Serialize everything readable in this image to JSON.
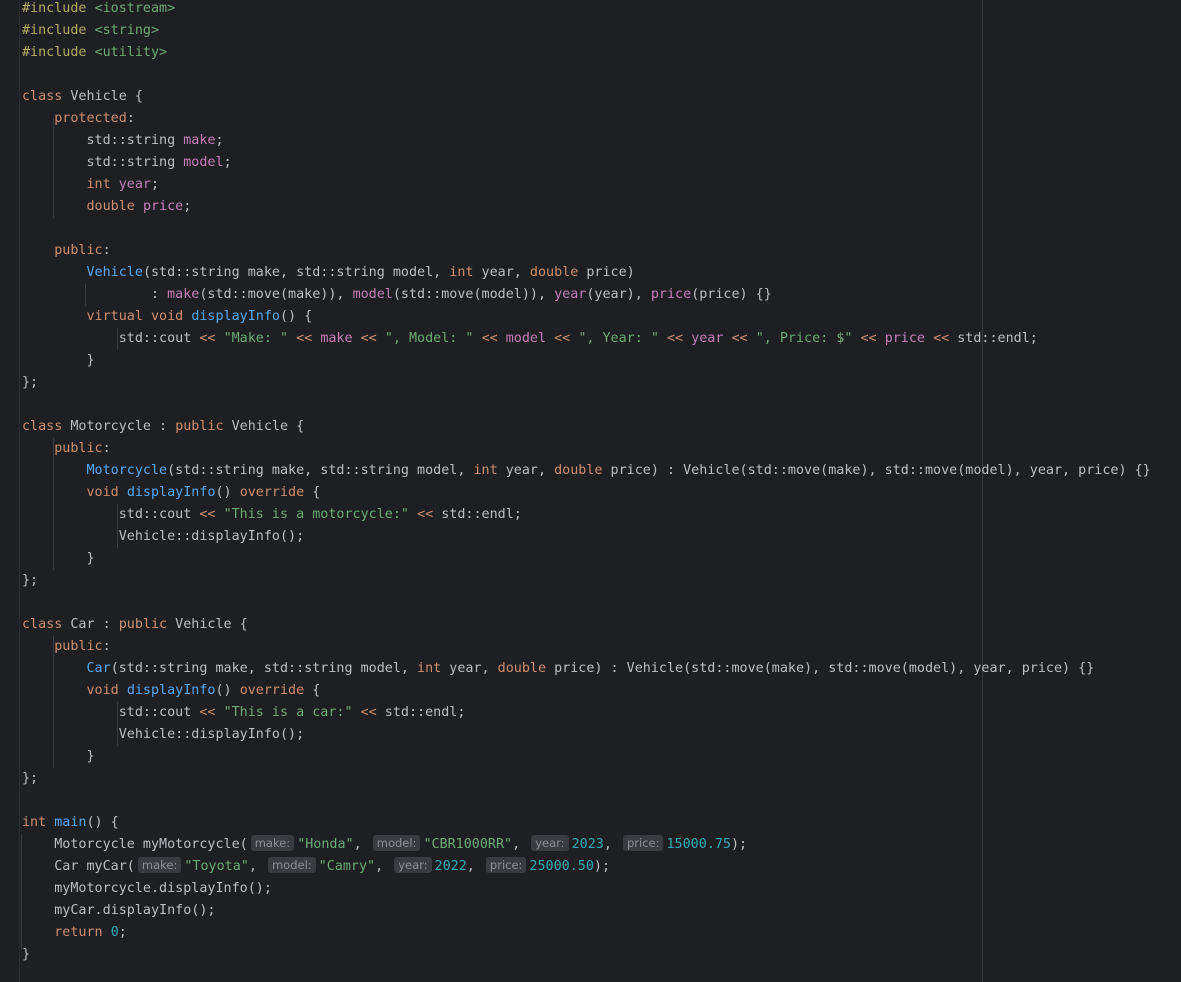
{
  "editor": {
    "language": "C++",
    "colors": {
      "background": "#1e1f22",
      "text": "#bcbec4",
      "keyword": "#cf8e6d",
      "string": "#6aab73",
      "number": "#2aacb8",
      "function": "#56a8f5",
      "field": "#c77dbb",
      "preprocessor": "#b3ae60",
      "inlay_hint": "#393b40"
    },
    "lines": [
      [
        [
          "pp",
          "#include"
        ],
        [
          "t",
          " "
        ],
        [
          "inc",
          "<iostream>"
        ]
      ],
      [
        [
          "pp",
          "#include"
        ],
        [
          "t",
          " "
        ],
        [
          "inc",
          "<string>"
        ]
      ],
      [
        [
          "pp",
          "#include"
        ],
        [
          "t",
          " "
        ],
        [
          "inc",
          "<utility>"
        ]
      ],
      [],
      [
        [
          "kw",
          "class"
        ],
        [
          "t",
          " Vehicle {"
        ]
      ],
      [
        [
          "t",
          "    "
        ],
        [
          "kw",
          "protected"
        ],
        [
          "t",
          ":"
        ]
      ],
      [
        [
          "t",
          "        std::string "
        ],
        [
          "fld",
          "make"
        ],
        [
          "t",
          ";"
        ]
      ],
      [
        [
          "t",
          "        std::string "
        ],
        [
          "fld",
          "model"
        ],
        [
          "t",
          ";"
        ]
      ],
      [
        [
          "t",
          "        "
        ],
        [
          "kw",
          "int"
        ],
        [
          "t",
          " "
        ],
        [
          "fld",
          "year"
        ],
        [
          "t",
          ";"
        ]
      ],
      [
        [
          "t",
          "        "
        ],
        [
          "kw",
          "double"
        ],
        [
          "t",
          " "
        ],
        [
          "fld",
          "price"
        ],
        [
          "t",
          ";"
        ]
      ],
      [],
      [
        [
          "t",
          "    "
        ],
        [
          "kw",
          "public"
        ],
        [
          "t",
          ":"
        ]
      ],
      [
        [
          "t",
          "        "
        ],
        [
          "fn",
          "Vehicle"
        ],
        [
          "t",
          "(std::string make, std::string model, "
        ],
        [
          "kw",
          "int"
        ],
        [
          "t",
          " year, "
        ],
        [
          "kw",
          "double"
        ],
        [
          "t",
          " price)"
        ]
      ],
      [
        [
          "t",
          "                : "
        ],
        [
          "fld",
          "make"
        ],
        [
          "t",
          "(std::move(make)), "
        ],
        [
          "fld",
          "model"
        ],
        [
          "t",
          "(std::move(model)), "
        ],
        [
          "fld",
          "year"
        ],
        [
          "t",
          "(year), "
        ],
        [
          "fld",
          "price"
        ],
        [
          "t",
          "(price) {}"
        ]
      ],
      [
        [
          "t",
          "        "
        ],
        [
          "kw",
          "virtual"
        ],
        [
          "t",
          " "
        ],
        [
          "kw",
          "void"
        ],
        [
          "t",
          " "
        ],
        [
          "fn",
          "displayInfo"
        ],
        [
          "t",
          "() {"
        ]
      ],
      [
        [
          "t",
          "            std::cout "
        ],
        [
          "kw",
          "<<"
        ],
        [
          "t",
          " "
        ],
        [
          "str",
          "\"Make: \""
        ],
        [
          "t",
          " "
        ],
        [
          "kw",
          "<<"
        ],
        [
          "t",
          " "
        ],
        [
          "fld",
          "make"
        ],
        [
          "t",
          " "
        ],
        [
          "kw",
          "<<"
        ],
        [
          "t",
          " "
        ],
        [
          "str",
          "\", Model: \""
        ],
        [
          "t",
          " "
        ],
        [
          "kw",
          "<<"
        ],
        [
          "t",
          " "
        ],
        [
          "fld",
          "model"
        ],
        [
          "t",
          " "
        ],
        [
          "kw",
          "<<"
        ],
        [
          "t",
          " "
        ],
        [
          "str",
          "\", Year: \""
        ],
        [
          "t",
          " "
        ],
        [
          "kw",
          "<<"
        ],
        [
          "t",
          " "
        ],
        [
          "fld",
          "year"
        ],
        [
          "t",
          " "
        ],
        [
          "kw",
          "<<"
        ],
        [
          "t",
          " "
        ],
        [
          "str",
          "\", Price: $\""
        ],
        [
          "t",
          " "
        ],
        [
          "kw",
          "<<"
        ],
        [
          "t",
          " "
        ],
        [
          "fld",
          "price"
        ],
        [
          "t",
          " "
        ],
        [
          "kw",
          "<<"
        ],
        [
          "t",
          " std::endl;"
        ]
      ],
      [
        [
          "t",
          "        }"
        ]
      ],
      [
        [
          "t",
          "};"
        ]
      ],
      [],
      [
        [
          "kw",
          "class"
        ],
        [
          "t",
          " Motorcycle : "
        ],
        [
          "kw",
          "public"
        ],
        [
          "t",
          " Vehicle {"
        ]
      ],
      [
        [
          "t",
          "    "
        ],
        [
          "kw",
          "public"
        ],
        [
          "t",
          ":"
        ]
      ],
      [
        [
          "t",
          "        "
        ],
        [
          "fn",
          "Motorcycle"
        ],
        [
          "t",
          "(std::string make, std::string model, "
        ],
        [
          "kw",
          "int"
        ],
        [
          "t",
          " year, "
        ],
        [
          "kw",
          "double"
        ],
        [
          "t",
          " price) : Vehicle(std::move(make), std::move(model), year, price) {}"
        ]
      ],
      [
        [
          "t",
          "        "
        ],
        [
          "kw",
          "void"
        ],
        [
          "t",
          " "
        ],
        [
          "fn",
          "displayInfo"
        ],
        [
          "t",
          "() "
        ],
        [
          "kw",
          "override"
        ],
        [
          "t",
          " {"
        ]
      ],
      [
        [
          "t",
          "            std::cout "
        ],
        [
          "kw",
          "<<"
        ],
        [
          "t",
          " "
        ],
        [
          "str",
          "\"This is a motorcycle:\""
        ],
        [
          "t",
          " "
        ],
        [
          "kw",
          "<<"
        ],
        [
          "t",
          " std::endl;"
        ]
      ],
      [
        [
          "t",
          "            Vehicle::displayInfo();"
        ]
      ],
      [
        [
          "t",
          "        }"
        ]
      ],
      [
        [
          "t",
          "};"
        ]
      ],
      [],
      [
        [
          "kw",
          "class"
        ],
        [
          "t",
          " Car : "
        ],
        [
          "kw",
          "public"
        ],
        [
          "t",
          " Vehicle {"
        ]
      ],
      [
        [
          "t",
          "    "
        ],
        [
          "kw",
          "public"
        ],
        [
          "t",
          ":"
        ]
      ],
      [
        [
          "t",
          "        "
        ],
        [
          "fn",
          "Car"
        ],
        [
          "t",
          "(std::string make, std::string model, "
        ],
        [
          "kw",
          "int"
        ],
        [
          "t",
          " year, "
        ],
        [
          "kw",
          "double"
        ],
        [
          "t",
          " price) : Vehicle(std::move(make), std::move(model), year, price) {}"
        ]
      ],
      [
        [
          "t",
          "        "
        ],
        [
          "kw",
          "void"
        ],
        [
          "t",
          " "
        ],
        [
          "fn",
          "displayInfo"
        ],
        [
          "t",
          "() "
        ],
        [
          "kw",
          "override"
        ],
        [
          "t",
          " {"
        ]
      ],
      [
        [
          "t",
          "            std::cout "
        ],
        [
          "kw",
          "<<"
        ],
        [
          "t",
          " "
        ],
        [
          "str",
          "\"This is a car:\""
        ],
        [
          "t",
          " "
        ],
        [
          "kw",
          "<<"
        ],
        [
          "t",
          " std::endl;"
        ]
      ],
      [
        [
          "t",
          "            Vehicle::displayInfo();"
        ]
      ],
      [
        [
          "t",
          "        }"
        ]
      ],
      [
        [
          "t",
          "};"
        ]
      ],
      [],
      [
        [
          "kw",
          "int"
        ],
        [
          "t",
          " "
        ],
        [
          "fn",
          "main"
        ],
        [
          "t",
          "() {"
        ]
      ],
      [
        [
          "t",
          "    Motorcycle myMotorcycle("
        ],
        [
          "hint",
          "make:"
        ],
        [
          "str",
          "\"Honda\""
        ],
        [
          "t",
          ", "
        ],
        [
          "hint",
          "model:"
        ],
        [
          "str",
          "\"CBR1000RR\""
        ],
        [
          "t",
          ", "
        ],
        [
          "hint",
          "year:"
        ],
        [
          "num",
          "2023"
        ],
        [
          "t",
          ", "
        ],
        [
          "hint",
          "price:"
        ],
        [
          "num",
          "15000.75"
        ],
        [
          "t",
          ");"
        ]
      ],
      [
        [
          "t",
          "    Car myCar("
        ],
        [
          "hint",
          "make:"
        ],
        [
          "str",
          "\"Toyota\""
        ],
        [
          "t",
          ", "
        ],
        [
          "hint",
          "model:"
        ],
        [
          "str",
          "\"Camry\""
        ],
        [
          "t",
          ", "
        ],
        [
          "hint",
          "year:"
        ],
        [
          "num",
          "2022"
        ],
        [
          "t",
          ", "
        ],
        [
          "hint",
          "price:"
        ],
        [
          "num",
          "25000.50"
        ],
        [
          "t",
          ");"
        ]
      ],
      [
        [
          "t",
          "    myMotorcycle.displayInfo();"
        ]
      ],
      [
        [
          "t",
          "    myCar.displayInfo();"
        ]
      ],
      [
        [
          "t",
          "    "
        ],
        [
          "kw",
          "return"
        ],
        [
          "t",
          " "
        ],
        [
          "num",
          "0"
        ],
        [
          "t",
          ";"
        ]
      ],
      [
        [
          "t",
          "}"
        ]
      ]
    ]
  }
}
